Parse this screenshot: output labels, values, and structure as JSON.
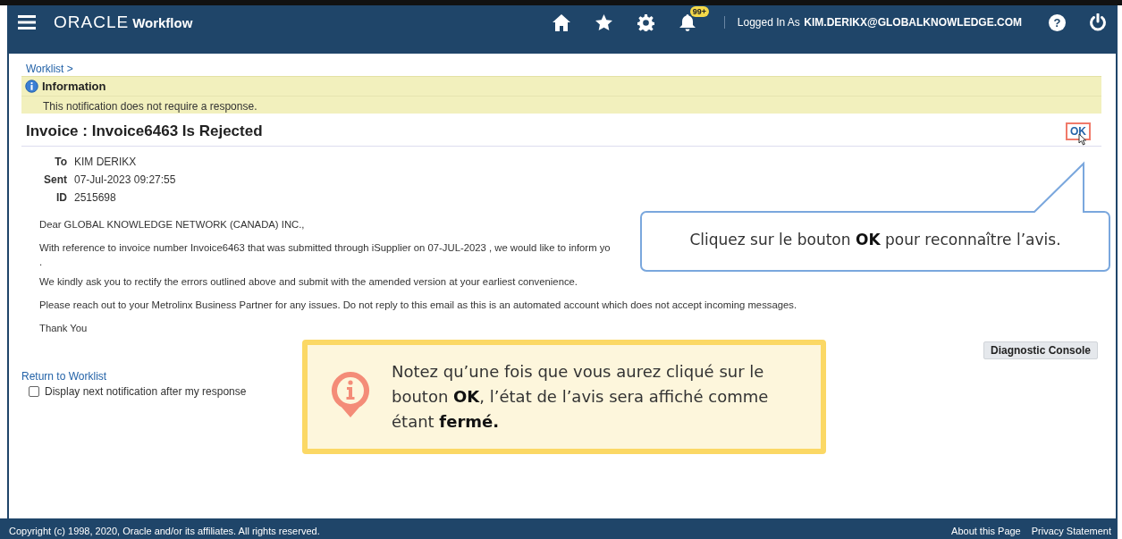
{
  "header": {
    "logo": "ORACLE",
    "app_name": "Workflow",
    "notification_count": "99+",
    "logged_in_label": "Logged In As",
    "user": "KIM.DERIKX@GLOBALKNOWLEDGE.COM",
    "help": "?"
  },
  "breadcrumb": {
    "link": "Worklist",
    "separator": ">"
  },
  "info_banner": {
    "title": "Information",
    "message": "This notification does not require a response."
  },
  "notification": {
    "title": "Invoice : Invoice6463 Is Rejected",
    "ok_button": "OK",
    "fields": [
      {
        "label": "To",
        "value": "KIM DERIKX"
      },
      {
        "label": "Sent",
        "value": "07-Jul-2023 09:27:55"
      },
      {
        "label": "ID",
        "value": "2515698"
      }
    ],
    "body": [
      "Dear GLOBAL KNOWLEDGE NETWORK (CANADA) INC.,",
      "With reference to invoice number Invoice6463 that was submitted through iSupplier on 07-JUL-2023 , we would like to inform yo",
      ".",
      "We kindly ask you to rectify the errors outlined above and submit with the amended version at your earliest convenience.",
      "Please reach out to your Metrolinx Business Partner for any issues. Do not reply to this email as this is an automated account which does not accept incoming messages.",
      "Thank You"
    ],
    "diagnostic_button": "Diagnostic Console"
  },
  "return_link": "Return to Worklist",
  "next_checkbox": {
    "label": "Display next notification after my response",
    "checked": false
  },
  "callouts": [
    {
      "kind": "speech",
      "text": "Cliquez sur le bouton **OK** pour reconnaître l’avis."
    },
    {
      "kind": "note",
      "text": "Notez qu’une fois que vous aurez cliqué sur le bouton **OK**, l’état de l’avis sera affiché comme étant **fermé.**"
    }
  ],
  "footer": {
    "copyright": "Copyright (c) 1998, 2020, Oracle and/or its affiliates. All rights reserved.",
    "links": [
      "About this Page",
      "Privacy Statement"
    ]
  }
}
